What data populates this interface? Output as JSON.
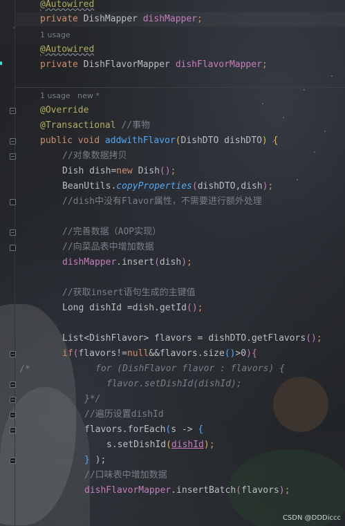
{
  "hints": {
    "usages_1": "1 usage",
    "usages_2": "1 usage   new *"
  },
  "code": {
    "l1_ann": "@Autowired",
    "l2_kw": "private",
    "l2_type": "DishMapper",
    "l2_field": "dishMapper",
    "l2_semi": ";",
    "l3_ann": "@Autowired",
    "l4_kw": "private",
    "l4_type": "DishFlavorMapper",
    "l4_field": "dishFlavorMapper",
    "l4_semi": ";",
    "l5_ann": "@Override",
    "l6_ann": "@Transactional",
    "l6_cm": "//事物",
    "l7_kw": "public void",
    "l7_fn": "addwithFlavor",
    "l7_params": "DishDTO dishDTO",
    "l8_cm": "//对象数据拷贝",
    "l9_a": "Dish dish=",
    "l9_kw": "new",
    "l9_b": "Dish",
    "l10_a": "BeanUtils.",
    "l10_it": "copyProperties",
    "l10_b": "dishDTO,dish",
    "l11_cm": "//dish中没有Flavor属性，不需要进行额外处理",
    "l12_cm": "//完善数据（AOP实现）",
    "l13_cm": "//向菜品表中增加数据",
    "l14_fld": "dishMapper",
    "l14_b": ".insert",
    "l14_c": "dish",
    "l15_cm": "//获取insert语句生成的主键值",
    "l16_a": "Long dishId =dish.getId",
    "l17_a": "List<DishFlavor> flavors = dishDTO.getFlavors",
    "l18_kw": "if",
    "l18_a": "flavors!=",
    "l18_kw2": "null",
    "l18_b": "&&flavors.size",
    "l18_c": ">0",
    "l19_cm": "for (DishFlavor flavor : flavors) {",
    "l20_cm": "flavor.setDishId(dishId);",
    "l21_cm": "}*/",
    "l22_cm": "//遍历设置dishId",
    "l23_a": "flavors.forEach",
    "l23_b": "s -> ",
    "l24_a": "s.setDishId",
    "l24_u": "dishId",
    "l25_a": " );",
    "l26_cm": "//口味表中增加数据",
    "l27_fld": "dishFlavorMapper",
    "l27_b": ".insertBatch",
    "l27_c": "flavors",
    "comment_open": "/*"
  },
  "watermark": "CSDN @DDDiccc"
}
